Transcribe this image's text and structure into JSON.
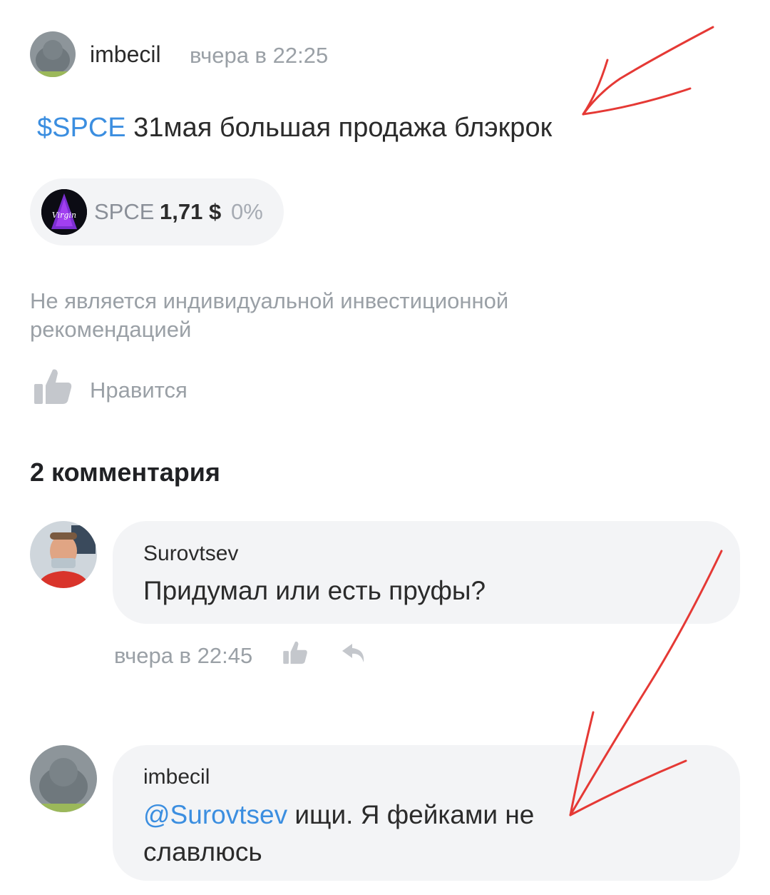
{
  "post": {
    "author": "imbecil",
    "time": "вчера в 22:25",
    "ticker_tag": "$SPCE",
    "text": " 31мая большая продажа блэкрок"
  },
  "ticker_chip": {
    "symbol": "SPCE",
    "price": "1,71 $",
    "change": "0%",
    "logo_icon": "virgin-galactic-logo"
  },
  "disclaimer": "Не является индивидуальной инвестиционной рекомендацией",
  "like": {
    "label": "Нравится",
    "icon": "thumbs-up-icon"
  },
  "comments": {
    "count_label": "2 комментария",
    "items": [
      {
        "author": "Surovtsev",
        "text": "Придумал или есть пруфы?",
        "time": "вчера в 22:45"
      },
      {
        "author": "imbecil",
        "mention": "@Surovtsev",
        "text_line1": " ищи. Я фейками не",
        "text_line2": "славлюсь"
      }
    ]
  },
  "colors": {
    "link": "#3b8ee0",
    "muted": "#9aa0a6",
    "bubble": "#f3f4f6",
    "annotation": "#e53935"
  }
}
